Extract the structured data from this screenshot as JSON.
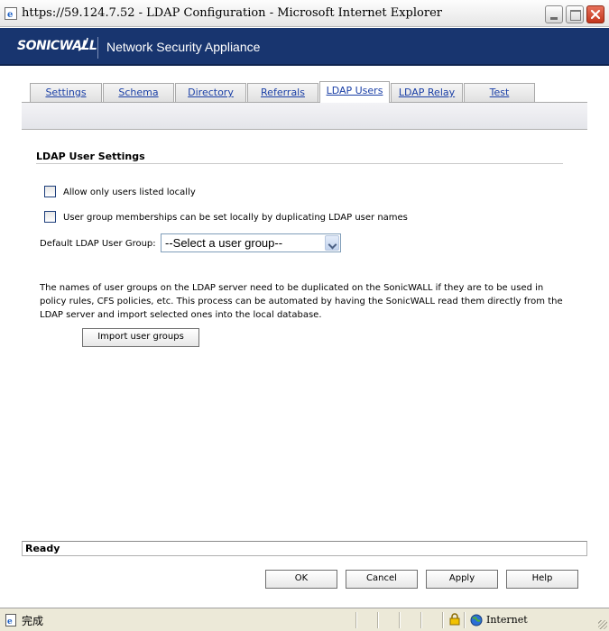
{
  "window": {
    "title": "https://59.124.7.52 - LDAP Configuration - Microsoft Internet Explorer"
  },
  "brand": {
    "logo_text": "SONICWALL",
    "product": "Network Security Appliance"
  },
  "tabs": [
    {
      "label": "Settings",
      "active": false
    },
    {
      "label": "Schema",
      "active": false
    },
    {
      "label": "Directory",
      "active": false
    },
    {
      "label": "Referrals",
      "active": false
    },
    {
      "label": "LDAP Users",
      "active": true
    },
    {
      "label": "LDAP Relay",
      "active": false
    },
    {
      "label": "Test",
      "active": false
    }
  ],
  "settings": {
    "section_title": "LDAP User Settings",
    "allow_local_label": "Allow only users listed locally",
    "allow_local_checked": false,
    "group_membership_label": "User group memberships can be set locally by duplicating LDAP user names",
    "group_membership_checked": false,
    "default_group_label": "Default LDAP User Group:",
    "default_group_value": "--Select a user group--",
    "description": "The names of user groups on the LDAP server need to be duplicated on the SonicWALL if they are to be used in policy rules, CFS policies, etc. This process can be automated by having the SonicWALL read them directly from the LDAP server and import selected ones into the local database.",
    "import_button": "Import user groups"
  },
  "status": {
    "text": "Ready"
  },
  "buttons": {
    "ok": "OK",
    "cancel": "Cancel",
    "apply": "Apply",
    "help": "Help"
  },
  "ie_status": {
    "text": "完成",
    "zone": "Internet"
  }
}
